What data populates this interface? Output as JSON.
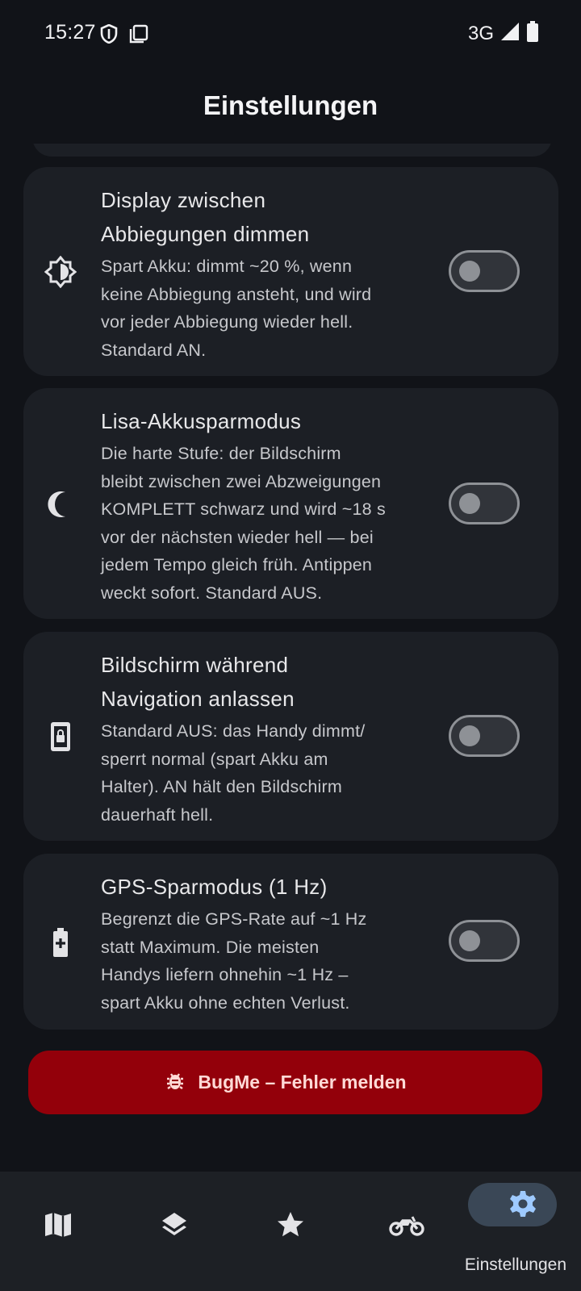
{
  "status_bar": {
    "time": "15:27",
    "network": "3G"
  },
  "page": {
    "title": "Einstellungen"
  },
  "settings": [
    {
      "icon": "brightness-half-icon",
      "title_line1": "Display zwischen",
      "title_line2": "Abbiegungen dimmen",
      "desc_lines": [
        "Spart Akku: dimmt ~20 %, wenn",
        "keine Abbiegung ansteht, und wird",
        "vor jeder Abbiegung wieder hell.",
        "Standard AN."
      ],
      "enabled": false
    },
    {
      "icon": "moon-icon",
      "title_line1": "Lisa-Akkusparmodus",
      "desc_lines": [
        "Die harte Stufe: der Bildschirm",
        "bleibt zwischen zwei Abzweigungen",
        "KOMPLETT schwarz und wird ~18 s",
        "vor der nächsten wieder hell — bei",
        "jedem Tempo gleich früh. Antippen",
        "weckt sofort. Standard AUS."
      ],
      "enabled": false
    },
    {
      "icon": "screen-lock-icon",
      "title_line1": "Bildschirm während",
      "title_line2": "Navigation anlassen",
      "desc_lines": [
        "Standard AUS: das Handy dimmt/",
        "sperrt normal (spart Akku am",
        "Halter). AN hält den Bildschirm",
        "dauerhaft hell."
      ],
      "enabled": false
    },
    {
      "icon": "battery-plus-icon",
      "title_line1": "GPS-Sparmodus (1 Hz)",
      "desc_lines": [
        "Begrenzt die GPS-Rate auf ~1 Hz",
        "statt Maximum. Die meisten",
        "Handys liefern ohnehin ~1 Hz –",
        "spart Akku ohne echten Verlust."
      ],
      "enabled": false
    }
  ],
  "bug_button": {
    "label": "BugMe – Fehler melden",
    "icon": "bug-icon"
  },
  "bottom_nav": {
    "items": [
      {
        "icon": "map-icon"
      },
      {
        "icon": "layers-icon"
      },
      {
        "icon": "star-icon"
      },
      {
        "icon": "motorcycle-icon"
      },
      {
        "icon": "gear-icon",
        "label": "Einstellungen",
        "active": true
      }
    ]
  },
  "colors": {
    "background": "#111318",
    "card": "#1c1f25",
    "bug_button": "#93000a",
    "nav_active_pill": "#3a4756",
    "accent_icon": "#9ecaff"
  }
}
